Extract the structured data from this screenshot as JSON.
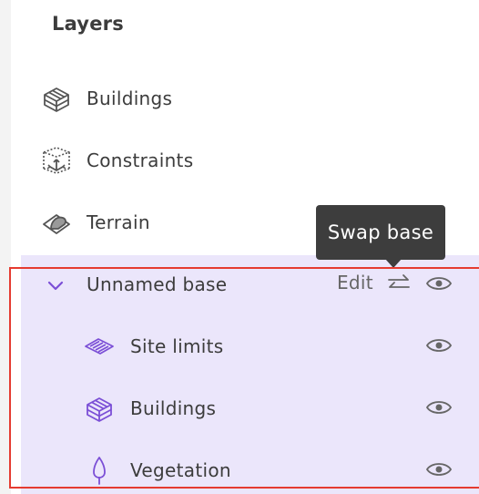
{
  "panel": {
    "title": "Layers"
  },
  "layers": [
    {
      "label": "Buildings",
      "icon": "buildings-icon"
    },
    {
      "label": "Constraints",
      "icon": "constraints-icon"
    },
    {
      "label": "Terrain",
      "icon": "terrain-icon"
    }
  ],
  "base": {
    "label": "Unnamed base",
    "edit_label": "Edit",
    "swap_icon": "swap-icon",
    "eye_icon": "eye-icon",
    "expanded": true,
    "children": [
      {
        "label": "Site limits",
        "icon": "site-limits-icon"
      },
      {
        "label": "Buildings",
        "icon": "buildings-icon"
      },
      {
        "label": "Vegetation",
        "icon": "vegetation-icon"
      }
    ]
  },
  "tooltip": {
    "text": "Swap base"
  },
  "colors": {
    "accent": "#7b4fd6",
    "selected_bg": "#ebe6fb",
    "tooltip_bg": "#3d3d3d",
    "highlight": "#e53b30"
  }
}
